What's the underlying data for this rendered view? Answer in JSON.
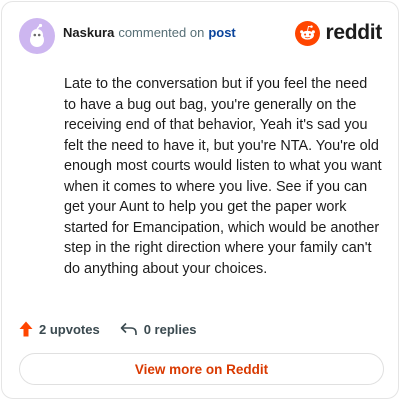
{
  "comment": {
    "author": "Naskura",
    "action_text": "commented on",
    "post_link": "post",
    "body": "Late to the conversation but if you feel the need to have a bug out bag, you're generally on the receiving end of that behavior, Yeah it's sad you felt the need to have it, but you're NTA. You're old enough most courts would listen to what you want when it comes to where you live. See if you can get your Aunt to help you get the paper work started for Emancipation, which would be another step in the right direction where your family can't do anything about your choices."
  },
  "brand": {
    "name": "reddit",
    "icon": "reddit-logo-icon",
    "color": "#ff4500"
  },
  "stats": {
    "upvotes_label": "2 upvotes",
    "replies_label": "0 replies",
    "upvote_icon": "upvote-arrow-icon",
    "upvote_color": "#ff4500",
    "reply_icon": "reply-arrow-icon"
  },
  "footer": {
    "view_more_label": "View more on Reddit",
    "accent_color": "#d93900"
  },
  "avatar": {
    "icon": "snoo-avatar-icon",
    "bg_color": "#cdb6f0"
  }
}
